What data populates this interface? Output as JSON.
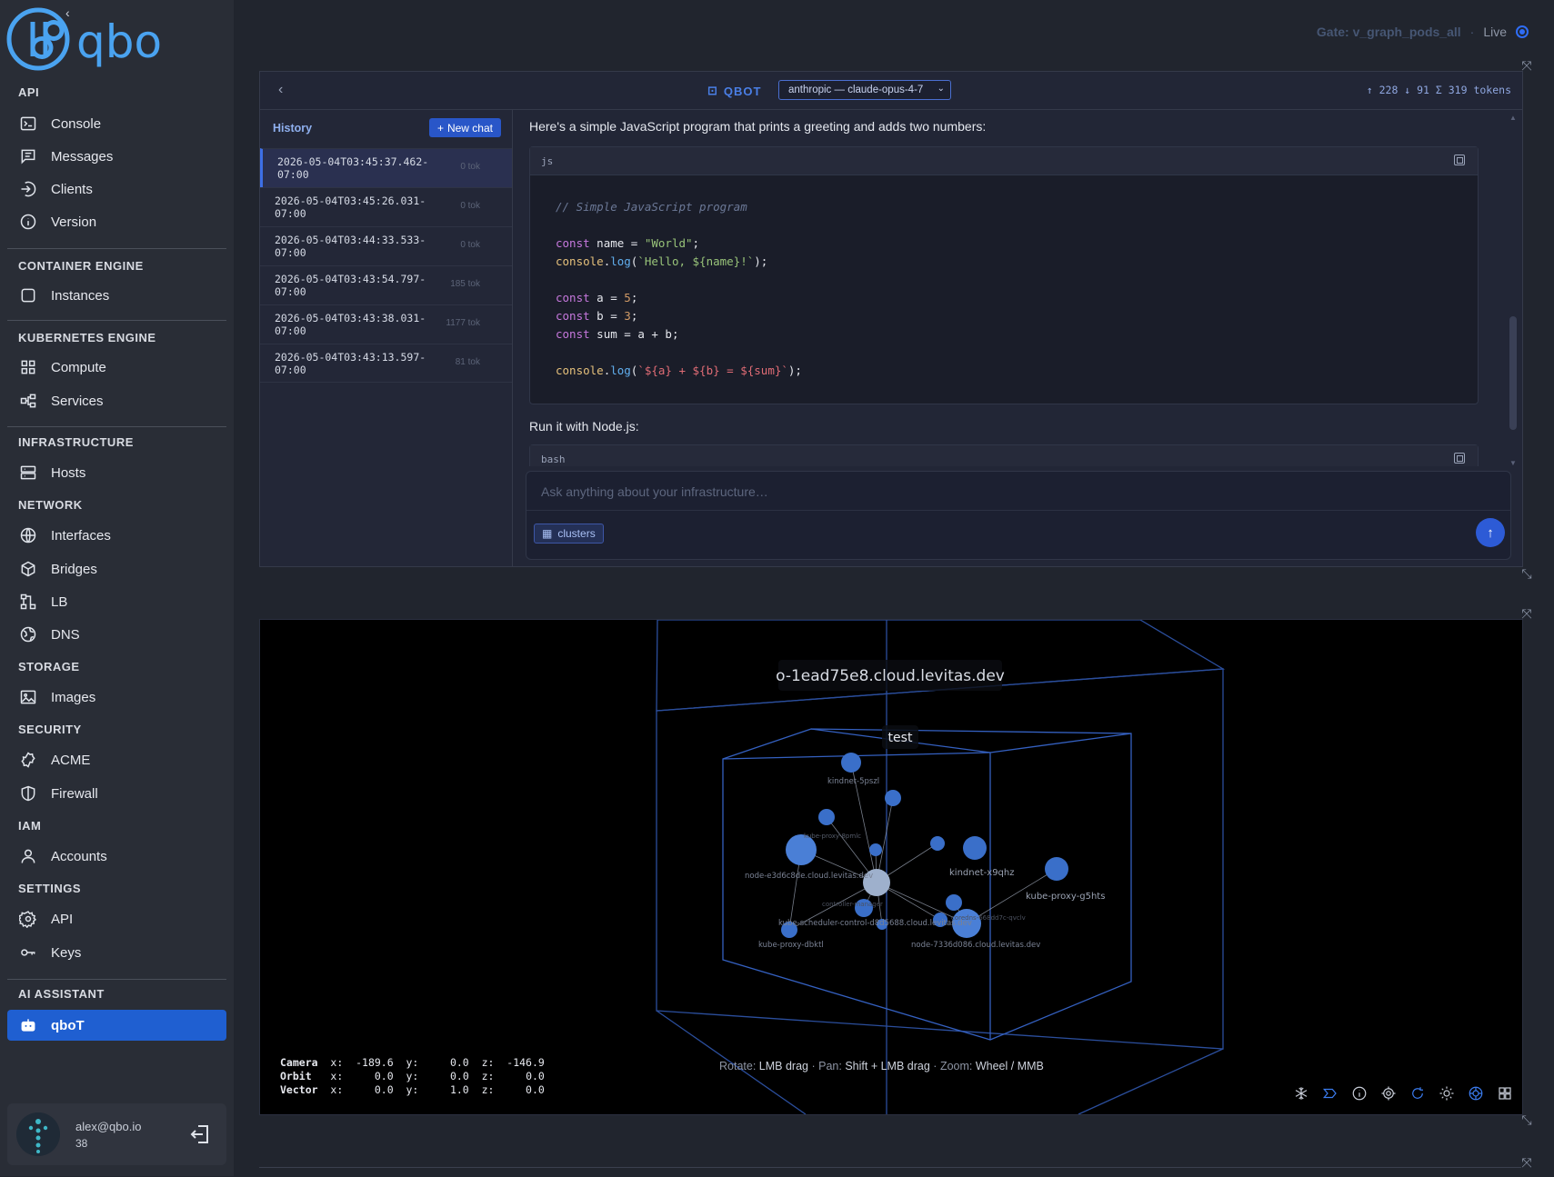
{
  "brand": {
    "name": "qbo"
  },
  "sidebar": {
    "sections": [
      {
        "title": "API"
      },
      {
        "title": "CONTAINER ENGINE"
      },
      {
        "title": "KUBERNETES ENGINE"
      },
      {
        "title": "INFRASTRUCTURE"
      },
      {
        "title": "NETWORK"
      },
      {
        "title": "STORAGE"
      },
      {
        "title": "SECURITY"
      },
      {
        "title": "IAM"
      },
      {
        "title": "SETTINGS"
      },
      {
        "title": "AI ASSISTANT"
      }
    ],
    "items": {
      "console": "Console",
      "messages": "Messages",
      "clients": "Clients",
      "version": "Version",
      "instances": "Instances",
      "compute": "Compute",
      "services": "Services",
      "hosts": "Hosts",
      "interfaces": "Interfaces",
      "bridges": "Bridges",
      "lb": "LB",
      "dns": "DNS",
      "images": "Images",
      "acme": "ACME",
      "firewall": "Firewall",
      "accounts": "Accounts",
      "api": "API",
      "keys": "Keys",
      "qbot": "qboT"
    },
    "user": {
      "email": "alex@qbo.io",
      "count": "38"
    }
  },
  "topbar": {
    "gate": "Gate: v_graph_pods_all",
    "sep": "·",
    "live": "Live"
  },
  "chat": {
    "title": "QBOT",
    "model": "anthropic — claude-opus-4-7",
    "tokens": "↑ 228 ↓ 91 Σ 319 tokens",
    "history_title": "History",
    "new_chat": "New chat",
    "history": [
      {
        "time": "2026-05-04T03:45:37.462-07:00",
        "tok": "0 tok"
      },
      {
        "time": "2026-05-04T03:45:26.031-07:00",
        "tok": "0 tok"
      },
      {
        "time": "2026-05-04T03:44:33.533-07:00",
        "tok": "0 tok"
      },
      {
        "time": "2026-05-04T03:43:54.797-07:00",
        "tok": "185 tok"
      },
      {
        "time": "2026-05-04T03:43:38.031-07:00",
        "tok": "1177 tok"
      },
      {
        "time": "2026-05-04T03:43:13.597-07:00",
        "tok": "81 tok"
      }
    ],
    "message_intro": "Here's a simple JavaScript program that prints a greeting and adds two numbers:",
    "code_lang": "js",
    "code": {
      "comment": "// Simple JavaScript program",
      "kw_const": "const",
      "name_var": "name",
      "name_val": "\"World\"",
      "console": "console",
      "log": "log",
      "hello_tpl": "`Hello, ${name}!`",
      "a_var": "a",
      "a_val": "5",
      "b_var": "b",
      "b_val": "3",
      "sum_var": "sum",
      "sum_expr": "a + b",
      "sum_tpl": "`${a} + ${b} = ${sum}`"
    },
    "message_run": "Run it with Node.js:",
    "code2_lang": "bash",
    "input_placeholder": "Ask anything about your infrastructure…",
    "chip": "clusters"
  },
  "graph": {
    "cluster_label": "o-1ead75e8.cloud.levitas.dev",
    "namespace_label": "test",
    "node_labels": [
      "kindnet-5pszl",
      "kube-proxy-8pmlc",
      "node-e3d6c8de.cloud.levitas.dev",
      "kindnet-x9qhz",
      "kube-proxy-g5hts",
      "kube-scheduler-control-d8d5688.cloud.levitas.dev",
      "kube-proxy-dbktl",
      "node-7336d086.cloud.levitas.dev",
      "controller-manager",
      "coredns-668dd7c-qvclv"
    ],
    "hud": {
      "camera": {
        "label": "Camera",
        "x": "-189.6",
        "y": "0.0",
        "z": "-146.9"
      },
      "orbit": {
        "label": "Orbit",
        "x": "0.0",
        "y": "0.0",
        "z": "0.0"
      },
      "vector": {
        "label": "Vector",
        "x": "0.0",
        "y": "1.0",
        "z": "0.0"
      }
    },
    "hint": {
      "rotate_l": "Rotate:",
      "rotate_v": "LMB drag",
      "pan_l": "Pan:",
      "pan_v": "Shift + LMB drag",
      "zoom_l": "Zoom:",
      "zoom_v": "Wheel / MMB",
      "sep": "·"
    },
    "tools": [
      "snowflake-icon",
      "tag-icon",
      "info-icon",
      "target-icon",
      "refresh-icon",
      "sun-icon",
      "crosshair-icon",
      "grid-icon"
    ]
  },
  "colors": {
    "accent": "#1f5fd1",
    "brand": "#4aa3f0",
    "node": "#3a78d8"
  }
}
